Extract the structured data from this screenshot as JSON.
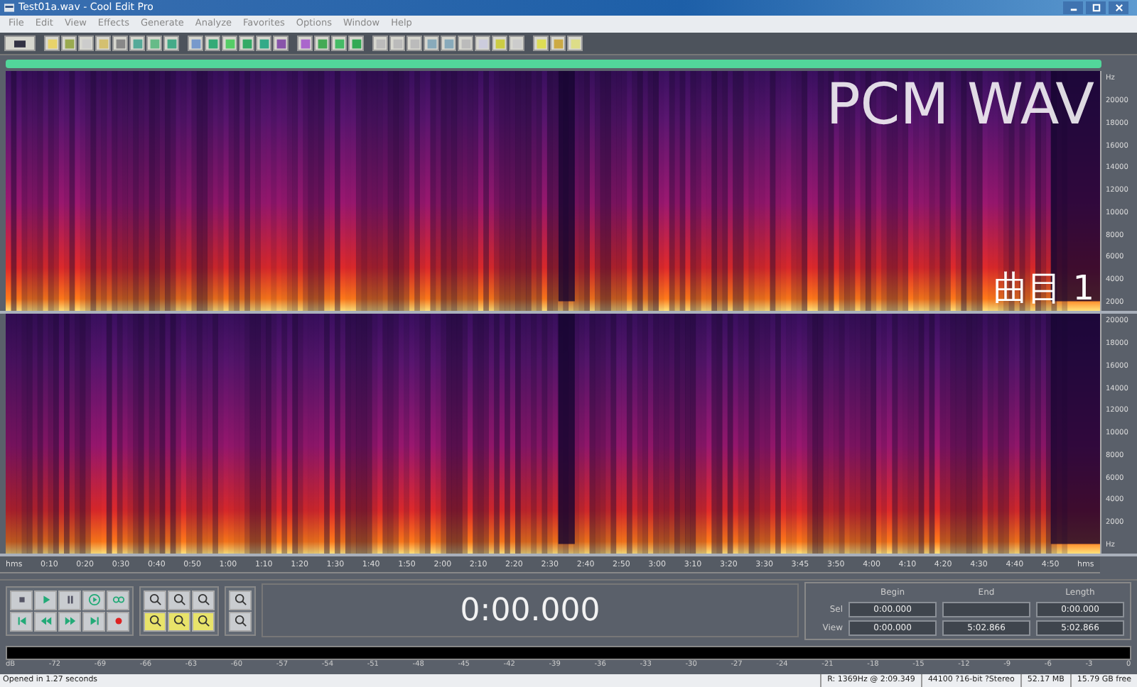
{
  "window": {
    "title": "Test01a.wav - Cool Edit Pro"
  },
  "menu": [
    "File",
    "Edit",
    "View",
    "Effects",
    "Generate",
    "Analyze",
    "Favorites",
    "Options",
    "Window",
    "Help"
  ],
  "overlay_labels": [
    "PCM WAV",
    "曲目 1"
  ],
  "channels": [
    {
      "scale": [
        "Hz",
        "20000",
        "18000",
        "16000",
        "14000",
        "12000",
        "10000",
        "8000",
        "6000",
        "4000",
        "2000"
      ]
    },
    {
      "scale": [
        "20000",
        "18000",
        "16000",
        "14000",
        "12000",
        "10000",
        "8000",
        "6000",
        "4000",
        "2000",
        "Hz"
      ]
    }
  ],
  "time_ruler": [
    "hms",
    "0:10",
    "0:20",
    "0:30",
    "0:40",
    "0:50",
    "1:00",
    "1:10",
    "1:20",
    "1:30",
    "1:40",
    "1:50",
    "2:00",
    "2:10",
    "2:20",
    "2:30",
    "2:40",
    "2:50",
    "3:00",
    "3:10",
    "3:20",
    "3:30",
    "3:45",
    "3:50",
    "4:00",
    "4:10",
    "4:20",
    "4:30",
    "4:40",
    "4:50",
    "hms"
  ],
  "time_display": "0:00.000",
  "selection": {
    "columns": [
      "Begin",
      "End",
      "Length"
    ],
    "rows": [
      {
        "label": "Sel",
        "begin": "0:00.000",
        "length": "0:00.000"
      },
      {
        "label": "View",
        "begin": "0:00.000",
        "end": "5:02.866",
        "length": "5:02.866"
      }
    ]
  },
  "level_meter": [
    "dB",
    "-72",
    "-69",
    "-66",
    "-63",
    "-60",
    "-57",
    "-54",
    "-51",
    "-48",
    "-45",
    "-42",
    "-39",
    "-36",
    "-33",
    "-30",
    "-27",
    "-24",
    "-21",
    "-18",
    "-15",
    "-12",
    "-9",
    "-6",
    "-3",
    "0"
  ],
  "status_bar": [
    "Opened in 1.27 seconds",
    "R: 1369Hz @  2:09.349",
    "44100 ?16-bit ?Stereo",
    "52.17 MB",
    "15.79 GB free"
  ]
}
